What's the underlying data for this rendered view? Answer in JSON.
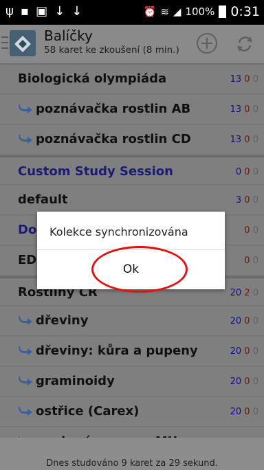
{
  "status_bar": {
    "battery": "100%",
    "time": "0:31"
  },
  "action_bar": {
    "title": "Balíčky",
    "subtitle": "58 karet ke zkoušení (8 min.)"
  },
  "decks": [
    {
      "name": "Biologická olympiáda",
      "sub": false,
      "custom": false,
      "new": "13",
      "learn": "0",
      "review": "0"
    },
    {
      "name": "poznávačka rostlin AB",
      "sub": true,
      "custom": false,
      "new": "13",
      "learn": "0",
      "review": "0"
    },
    {
      "name": "poznávačka rostlin CD",
      "sub": true,
      "custom": false,
      "new": "13",
      "learn": "0",
      "review": "0"
    },
    {
      "name": "Custom Study Session",
      "sub": false,
      "custom": true,
      "new": "0",
      "learn": "0",
      "review": "0"
    },
    {
      "name": "default",
      "sub": false,
      "custom": false,
      "new": "3",
      "learn": "0",
      "review": "0"
    },
    {
      "name": "Doc",
      "sub": false,
      "custom": true,
      "new": "",
      "learn": "0",
      "review": "0"
    },
    {
      "name": "EDU",
      "sub": false,
      "custom": false,
      "new": "",
      "learn": "0",
      "review": "0"
    },
    {
      "name": "Rostliny ČR",
      "sub": false,
      "custom": false,
      "new": "20",
      "learn": "2",
      "review": "0"
    },
    {
      "name": "dřeviny",
      "sub": true,
      "custom": false,
      "new": "20",
      "learn": "0",
      "review": "0"
    },
    {
      "name": "dřeviny: kůra a pupeny",
      "sub": true,
      "custom": false,
      "new": "20",
      "learn": "0",
      "review": "0"
    },
    {
      "name": "graminoidy",
      "sub": true,
      "custom": false,
      "new": "20",
      "learn": "0",
      "review": "0"
    },
    {
      "name": "ostřice (Carex)",
      "sub": true,
      "custom": false,
      "new": "20",
      "learn": "0",
      "review": "0"
    },
    {
      "name": "povinné pensum MU",
      "sub": true,
      "custom": false,
      "new": "20",
      "learn": "0",
      "review": "0"
    }
  ],
  "footer": {
    "text": "Dnes studováno 9 karet za 29 sekund."
  },
  "dialog": {
    "message": "Kolekce synchronizována",
    "ok_label": "Ok"
  },
  "colors": {
    "highlight_circle": "#e01313",
    "new_count": "#12127a",
    "learn_count": "#7a1010"
  }
}
